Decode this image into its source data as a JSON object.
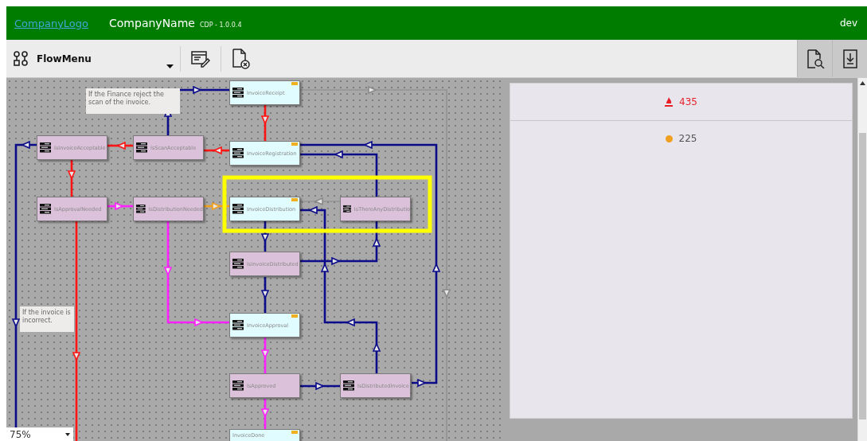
{
  "header": {
    "logo": "CompanyLogo",
    "name": "CompanyName",
    "version": "CDP - 1.0.0.4",
    "user": "dev"
  },
  "toolbar": {
    "flow_menu": "FlowMenu"
  },
  "canvas": {
    "nodes": [
      {
        "label": "InvoiceReceipt",
        "kind": "task"
      },
      {
        "label": "IsInvoiceAcceptable",
        "kind": "decision"
      },
      {
        "label": "IsScanAcceptable",
        "kind": "decision"
      },
      {
        "label": "InvoiceRegistration",
        "kind": "task"
      },
      {
        "label": "IsApprovalNeeded",
        "kind": "decision"
      },
      {
        "label": "IsDistributionNeeded",
        "kind": "decision"
      },
      {
        "label": "InvoiceDistribution",
        "kind": "task"
      },
      {
        "label": "IsThereAnyDistributio",
        "kind": "decision"
      },
      {
        "label": "IsInvoiceDistributed",
        "kind": "decision"
      },
      {
        "label": "InvoiceApproval",
        "kind": "task"
      },
      {
        "label": "IsApproved",
        "kind": "decision"
      },
      {
        "label": "IsDistributedInvoice",
        "kind": "decision"
      },
      {
        "label": "InvoiceDone",
        "kind": "task"
      }
    ],
    "notes": [
      "If the Finance reject the scan of the invoice.",
      "If the invoice is incorrect."
    ],
    "zoom": "75%"
  },
  "panel": {
    "rows": [
      {
        "kind": "alert",
        "value": "435",
        "color": "#e8202a"
      },
      {
        "kind": "dot",
        "value": "225",
        "color": "#f0a020"
      }
    ]
  }
}
